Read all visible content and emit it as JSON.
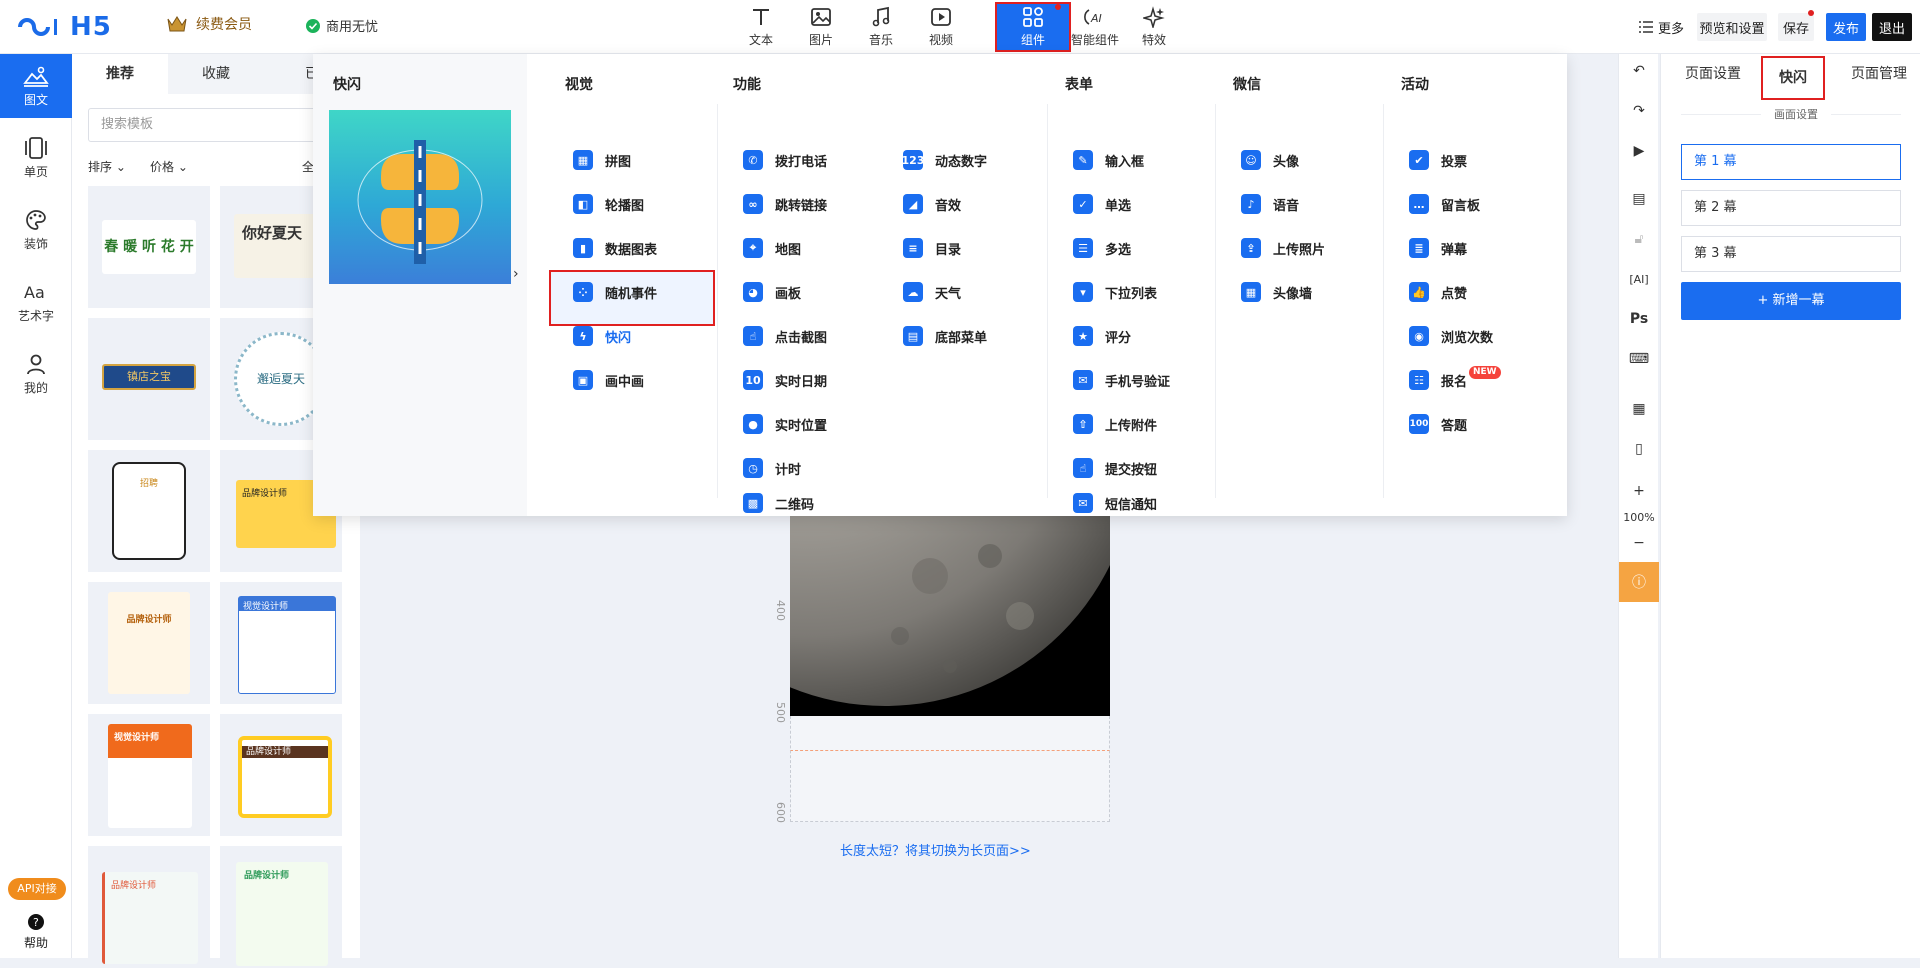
{
  "header": {
    "logo": "H5",
    "vip_label": "续费会员",
    "commercial_label": "商用无忧",
    "tools": [
      {
        "label": "文本",
        "icon": "text-icon"
      },
      {
        "label": "图片",
        "icon": "image-icon"
      },
      {
        "label": "音乐",
        "icon": "music-icon"
      },
      {
        "label": "视频",
        "icon": "video-icon"
      },
      {
        "label": "组件",
        "icon": "components-icon"
      },
      {
        "label": "智能组件",
        "icon": "ai-icon"
      },
      {
        "label": "特效",
        "icon": "sparkle-icon"
      }
    ],
    "more_label": "更多",
    "preview_label": "预览和设置",
    "save_label": "保存",
    "publish_label": "发布",
    "exit_label": "退出"
  },
  "leftnav": [
    {
      "label": "图文",
      "icon": "image-text-icon"
    },
    {
      "label": "单页",
      "icon": "single-page-icon"
    },
    {
      "label": "装饰",
      "icon": "palette-icon"
    },
    {
      "label": "艺术字",
      "icon": "art-text-icon"
    },
    {
      "label": "我的",
      "icon": "user-icon"
    }
  ],
  "api_label": "API对接",
  "help_label": "帮助",
  "template_panel": {
    "tabs": [
      "推荐",
      "收藏",
      "已"
    ],
    "search_placeholder": "搜索模板",
    "sort_label": "排序",
    "price_label": "价格",
    "all_label": "全",
    "thumbs": [
      {
        "text": "春 暖 听 花 开"
      },
      {
        "text": "你好夏天"
      },
      {
        "text": "镇店之宝"
      },
      {
        "text": "邂逅夏天"
      },
      {
        "text": "招聘"
      },
      {
        "text": "品牌设计师"
      },
      {
        "text": "品牌设计师"
      },
      {
        "text": "视觉设计师"
      },
      {
        "text": "视觉设计师"
      },
      {
        "text": "品牌设计师"
      },
      {
        "text": "品牌设计师"
      },
      {
        "text": "品牌设计师"
      }
    ]
  },
  "dropdown": {
    "title": "快闪",
    "columns": {
      "visual": {
        "header": "视觉",
        "items": [
          "拼图",
          "轮播图",
          "数据图表",
          "随机事件",
          "快闪",
          "画中画"
        ]
      },
      "function": {
        "header": "功能",
        "items_a": [
          "拨打电话",
          "跳转链接",
          "地图",
          "画板",
          "点击截图",
          "实时日期",
          "实时位置",
          "计时",
          "二维码"
        ],
        "items_b": [
          "动态数字",
          "音效",
          "目录",
          "天气",
          "底部菜单"
        ]
      },
      "form": {
        "header": "表单",
        "items": [
          "输入框",
          "单选",
          "多选",
          "下拉列表",
          "评分",
          "手机号验证",
          "上传附件",
          "提交按钮",
          "短信通知"
        ]
      },
      "wechat": {
        "header": "微信",
        "items": [
          "头像",
          "语音",
          "上传照片",
          "头像墙"
        ]
      },
      "activity": {
        "header": "活动",
        "items": [
          "投票",
          "留言板",
          "弹幕",
          "点赞",
          "浏览次数",
          "报名",
          "答题"
        ]
      }
    },
    "new_badge": "NEW"
  },
  "canvas": {
    "ruler_marks": [
      "400",
      "500",
      "600"
    ],
    "hint": "长度太短？将其切换为长页面>>"
  },
  "right_tools": {
    "zoom": "100%",
    "ps_label": "Ps"
  },
  "right_panel": {
    "tabs": [
      "页面设置",
      "快闪",
      "页面管理"
    ],
    "tooltip": "画面设置",
    "scenes": [
      "第 1 幕",
      "第 2 幕",
      "第 3 幕"
    ],
    "add_label": "+ 新增一幕"
  },
  "colors": {
    "accent": "#1a6df0",
    "highlight": "#e02020"
  }
}
